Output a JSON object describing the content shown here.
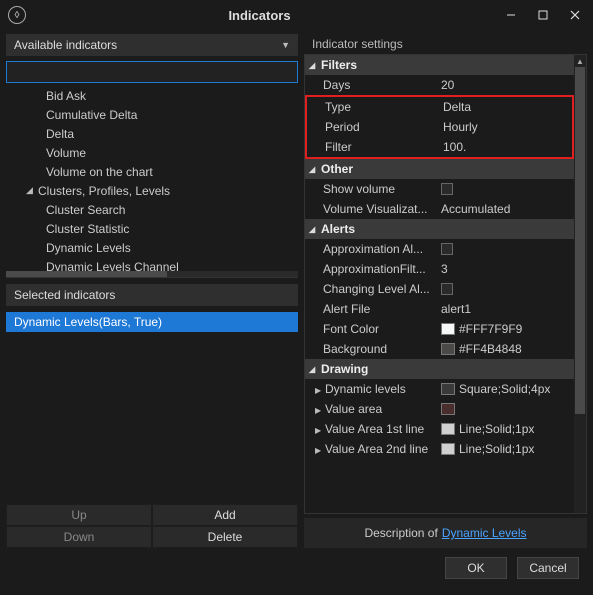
{
  "window": {
    "title": "Indicators"
  },
  "left_panel": {
    "available_header": "Available indicators",
    "tree": {
      "items": [
        {
          "label": "Bid Ask",
          "level": 1
        },
        {
          "label": "Cumulative Delta",
          "level": 1
        },
        {
          "label": "Delta",
          "level": 1
        },
        {
          "label": "Volume",
          "level": 1
        },
        {
          "label": "Volume on the chart",
          "level": 1
        },
        {
          "label": "Clusters, Profiles, Levels",
          "level": 0,
          "expanded": true
        },
        {
          "label": "Cluster Search",
          "level": 1
        },
        {
          "label": "Cluster Statistic",
          "level": 1
        },
        {
          "label": "Dynamic Levels",
          "level": 1
        },
        {
          "label": "Dynamic Levels Channel",
          "level": 1
        }
      ]
    },
    "selected_header": "Selected indicators",
    "selected_item": "Dynamic Levels(Bars, True)",
    "buttons": {
      "up": "Up",
      "down": "Down",
      "add": "Add",
      "delete": "Delete"
    }
  },
  "right_panel": {
    "header": "Indicator settings",
    "categories": {
      "filters": {
        "title": "Filters",
        "rows": [
          {
            "key": "Days",
            "val": "20",
            "hl": false
          },
          {
            "key": "Type",
            "val": "Delta",
            "hl": true
          },
          {
            "key": "Period",
            "val": "Hourly",
            "hl": true
          },
          {
            "key": "Filter",
            "val": "100.",
            "hl": true
          }
        ]
      },
      "other": {
        "title": "Other",
        "rows": [
          {
            "key": "Show volume",
            "val_checkbox": true
          },
          {
            "key": "Volume Visualizat...",
            "val": "Accumulated"
          }
        ]
      },
      "alerts": {
        "title": "Alerts",
        "rows": [
          {
            "key": "Approximation Al...",
            "val_checkbox": true
          },
          {
            "key": "ApproximationFilt...",
            "val": "3"
          },
          {
            "key": "Changing Level Al...",
            "val_checkbox": true
          },
          {
            "key": "Alert File",
            "val": "alert1"
          },
          {
            "key": "Font Color",
            "swatch": "#FFF7F9F9",
            "swatch_color": "#f7f9f9",
            "val": "#FFF7F9F9"
          },
          {
            "key": "Background",
            "swatch": "#FF4B4848",
            "swatch_color": "#4b4848",
            "val": "#FF4B4848"
          }
        ]
      },
      "drawing": {
        "title": "Drawing",
        "rows": [
          {
            "key": "Dynamic levels",
            "expandable": true,
            "swatch_color": "#3a3a3a",
            "val": "Square;Solid;4px"
          },
          {
            "key": "Value area",
            "expandable": true,
            "swatch_color": "#4a2e2e",
            "val": ""
          },
          {
            "key": "Value Area 1st line",
            "expandable": true,
            "swatch_color": "#d0d0d0",
            "val": "Line;Solid;1px"
          },
          {
            "key": "Value Area 2nd line",
            "expandable": true,
            "swatch_color": "#d0d0d0",
            "val": "Line;Solid;1px"
          }
        ]
      }
    },
    "description_prefix": "Description of",
    "description_link": "Dynamic Levels"
  },
  "footer": {
    "ok": "OK",
    "cancel": "Cancel"
  }
}
